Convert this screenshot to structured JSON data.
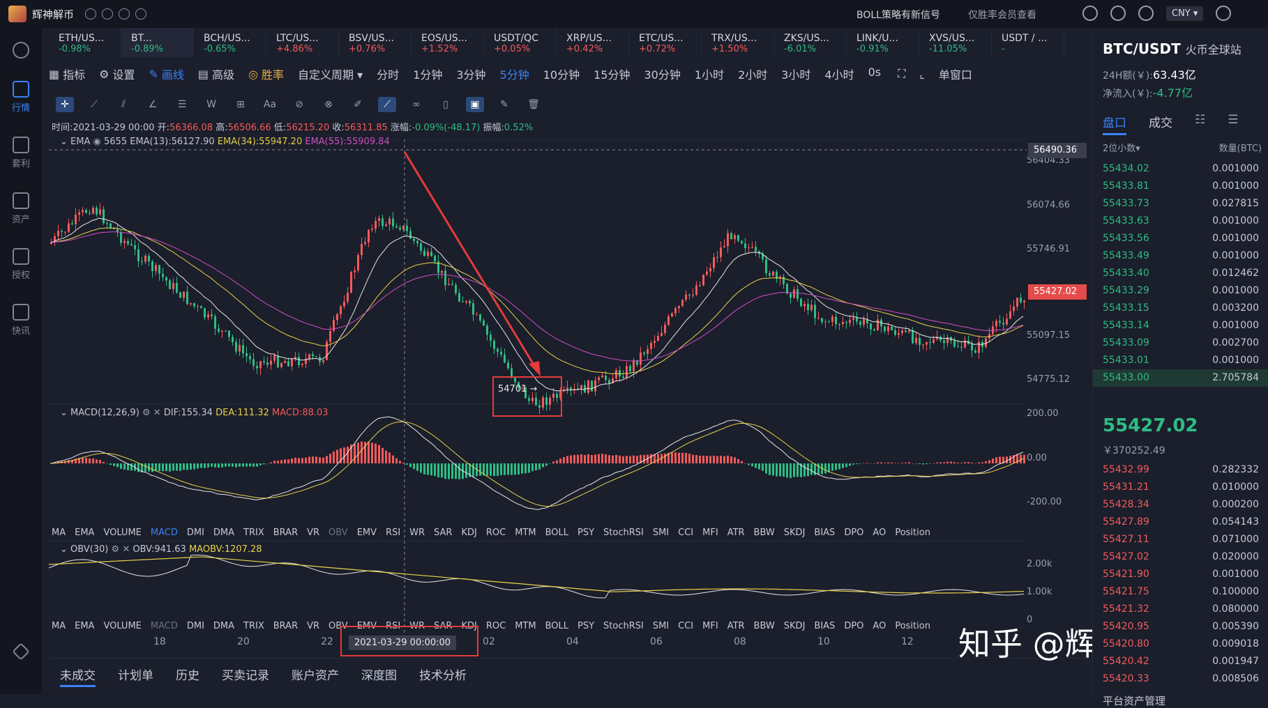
{
  "app": {
    "name": "辉神解币",
    "notice": "BOLL策略有新信号",
    "notice2": "仅胜率会员查看",
    "currency": "CNY ▾"
  },
  "sidebar": [
    {
      "label": "行情",
      "active": true
    },
    {
      "label": "套利"
    },
    {
      "label": "资产"
    },
    {
      "label": "授权"
    },
    {
      "label": "快讯"
    }
  ],
  "tabs": [
    {
      "name": "ETH/US...",
      "chg": "-0.98%",
      "dir": "down"
    },
    {
      "name": "BT...",
      "chg": "-0.89%",
      "dir": "down"
    },
    {
      "name": "BCH/US...",
      "chg": "-0.65%",
      "dir": "down"
    },
    {
      "name": "LTC/US...",
      "chg": "+4.86%",
      "dir": "up"
    },
    {
      "name": "BSV/US...",
      "chg": "+0.76%",
      "dir": "up"
    },
    {
      "name": "EOS/US...",
      "chg": "+1.52%",
      "dir": "up"
    },
    {
      "name": "USDT/QC",
      "chg": "+0.05%",
      "dir": "up"
    },
    {
      "name": "XRP/US...",
      "chg": "+0.42%",
      "dir": "up"
    },
    {
      "name": "ETC/US...",
      "chg": "+0.72%",
      "dir": "up"
    },
    {
      "name": "TRX/US...",
      "chg": "+1.50%",
      "dir": "up"
    },
    {
      "name": "ZKS/US...",
      "chg": "-6.01%",
      "dir": "down"
    },
    {
      "name": "LINK/U...",
      "chg": "-0.91%",
      "dir": "down"
    },
    {
      "name": "XVS/US...",
      "chg": "-11.05%",
      "dir": "down"
    },
    {
      "name": "USDT / ...",
      "chg": "-",
      "dir": "down"
    }
  ],
  "toolbar": {
    "indicator": "指标",
    "settings": "设置",
    "draw": "画线",
    "advanced": "高级",
    "winrate": "胜率",
    "custom": "自定义周期 ▾",
    "window": "单窗口"
  },
  "periods": [
    "分时",
    "1分钟",
    "3分钟",
    "5分钟",
    "10分钟",
    "15分钟",
    "30分钟",
    "1小时",
    "2小时",
    "3小时",
    "4小时",
    "0s"
  ],
  "active_period": "5分钟",
  "ohlc": {
    "time": "时间:2021-03-29 00:00",
    "open_l": "开:",
    "open": "56366.08",
    "high_l": "高:",
    "high": "56506.66",
    "low_l": "低:",
    "low": "56215.20",
    "close_l": "收:",
    "close": "56311.85",
    "chg_l": "涨幅:",
    "chg": "-0.09%(-48.17)",
    "amp_l": "振幅:",
    "amp": "0.52%"
  },
  "ema_legend": {
    "name": "EMA",
    "e1": "5655",
    "e13": "EMA(13):56127.90",
    "e34": "EMA(34):55947.20",
    "e55": "EMA(55):55909.84"
  },
  "macd_legend": {
    "name": "MACD(12,26,9)",
    "dif": "DIF:155.34",
    "dea": "DEA:111.32",
    "macd": "MACD:88.03"
  },
  "obv_legend": {
    "name": "OBV(30)",
    "obv": "OBV:941.63",
    "maobv": "MAOBV:1207.28"
  },
  "price_axis": [
    "56404.33",
    "56074.66",
    "55746.91",
    "55097.15",
    "54775.12"
  ],
  "cross_price": "56490.36",
  "last_price_tag": "55427.02",
  "macd_axis": [
    "200.00",
    "0.00",
    "-200.00"
  ],
  "obv_axis": [
    "2.00k",
    "1.00k",
    "0"
  ],
  "annotation": "54701 →",
  "indicators": [
    "MA",
    "EMA",
    "VOLUME",
    "MACD",
    "DMI",
    "DMA",
    "TRIX",
    "BRAR",
    "VR",
    "OBV",
    "EMV",
    "RSI",
    "WR",
    "SAR",
    "KDJ",
    "ROC",
    "MTM",
    "BOLL",
    "PSY",
    "StochRSI",
    "SMI",
    "CCI",
    "MFI",
    "ATR",
    "BBW",
    "SKDJ",
    "BIAS",
    "DPO",
    "AO",
    "Position"
  ],
  "indicators2": [
    "MA",
    "EMA",
    "VOLUME",
    "MACD",
    "DMI",
    "DMA",
    "TRIX",
    "BRAR",
    "VR",
    "OBV",
    "EMV",
    "RSI",
    "WR",
    "SAR",
    "KDJ",
    "ROC",
    "MTM",
    "BOLL",
    "PSY",
    "StochRSI",
    "SMI",
    "CCI",
    "MFI",
    "ATR",
    "BBW",
    "SKDJ",
    "BIAS",
    "DPO",
    "AO",
    "Position"
  ],
  "dates": [
    "18",
    "20",
    "22",
    "02",
    "04",
    "06",
    "08",
    "10",
    "12"
  ],
  "cross_date": "2021-03-29 00:00:00",
  "bottom_tabs": [
    "未成交",
    "计划单",
    "历史",
    "买卖记录",
    "账户资产",
    "深度图",
    "技术分析"
  ],
  "watermark": "知乎 @辉神解币",
  "right": {
    "title": "BTC/USDT",
    "exchange": "火币全球站",
    "vol24_label": "24H额(￥):",
    "vol24": "63.43亿",
    "net_label": "净流入(￥):",
    "net": "-4.77亿",
    "tab1": "盘口",
    "tab2": "成交",
    "precision": "2位小数▾",
    "qty_head": "数量(BTC)",
    "last": "55427.02",
    "last_cny": "￥370252.49",
    "footer": "平台资产管理"
  },
  "asks": [
    [
      "55434.02",
      "0.001000"
    ],
    [
      "55433.81",
      "0.001000"
    ],
    [
      "55433.73",
      "0.027815"
    ],
    [
      "55433.63",
      "0.001000"
    ],
    [
      "55433.56",
      "0.001000"
    ],
    [
      "55433.49",
      "0.001000"
    ],
    [
      "55433.40",
      "0.012462"
    ],
    [
      "55433.29",
      "0.001000"
    ],
    [
      "55433.15",
      "0.003200"
    ],
    [
      "55433.14",
      "0.001000"
    ],
    [
      "55433.09",
      "0.002700"
    ],
    [
      "55433.01",
      "0.001000"
    ],
    [
      "55433.00",
      "2.705784"
    ]
  ],
  "bids": [
    [
      "55432.99",
      "0.282332"
    ],
    [
      "55431.21",
      "0.010000"
    ],
    [
      "55428.34",
      "0.000200"
    ],
    [
      "55427.89",
      "0.054143"
    ],
    [
      "55427.11",
      "0.071000"
    ],
    [
      "55427.02",
      "0.020000"
    ],
    [
      "55421.90",
      "0.001000"
    ],
    [
      "55421.75",
      "0.100000"
    ],
    [
      "55421.32",
      "0.080000"
    ],
    [
      "55420.95",
      "0.005390"
    ],
    [
      "55420.80",
      "0.009018"
    ],
    [
      "55420.42",
      "0.001947"
    ],
    [
      "55420.33",
      "0.008506"
    ]
  ]
}
